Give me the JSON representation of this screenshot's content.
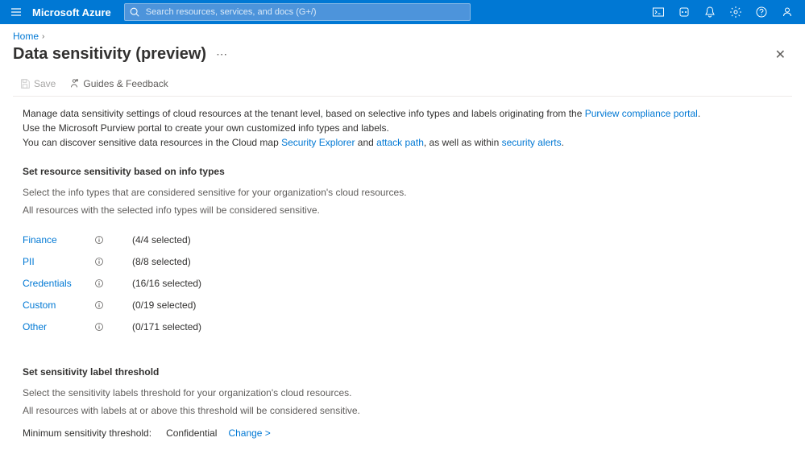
{
  "brand": "Microsoft Azure",
  "search": {
    "placeholder": "Search resources, services, and docs (G+/)"
  },
  "breadcrumb": {
    "home": "Home"
  },
  "page": {
    "title": "Data sensitivity (preview)"
  },
  "toolbar": {
    "save": "Save",
    "guides": "Guides & Feedback"
  },
  "intro": {
    "line1_pre": "Manage data sensitivity settings of cloud resources at the tenant level, based on selective info types and labels originating from the ",
    "line1_link": "Purview compliance portal",
    "line1_post": ".",
    "line2": "Use the Microsoft Purview portal to create your own customized info types and labels.",
    "line3_pre": "You can discover sensitive data resources in the Cloud map ",
    "line3_link1": "Security Explorer",
    "line3_mid1": " and ",
    "line3_link2": "attack path",
    "line3_mid2": ", as well as within ",
    "line3_link3": "security alerts",
    "line3_post": "."
  },
  "section1": {
    "heading": "Set resource sensitivity based on info types",
    "desc1": "Select the info types that are considered sensitive for your organization's cloud resources.",
    "desc2": "All resources with the selected info types will be considered sensitive."
  },
  "infoTypes": [
    {
      "label": "Finance",
      "count": "(4/4 selected)"
    },
    {
      "label": "PII",
      "count": "(8/8 selected)"
    },
    {
      "label": "Credentials",
      "count": "(16/16 selected)"
    },
    {
      "label": "Custom",
      "count": "(0/19 selected)"
    },
    {
      "label": "Other",
      "count": "(0/171 selected)"
    }
  ],
  "section2": {
    "heading": "Set sensitivity label threshold",
    "desc1": "Select the sensitivity labels threshold for your organization's cloud resources.",
    "desc2": "All resources with labels at or above this threshold will be considered sensitive.",
    "thresholdLabel": "Minimum sensitivity threshold:",
    "thresholdValue": "Confidential",
    "change": "Change >"
  }
}
